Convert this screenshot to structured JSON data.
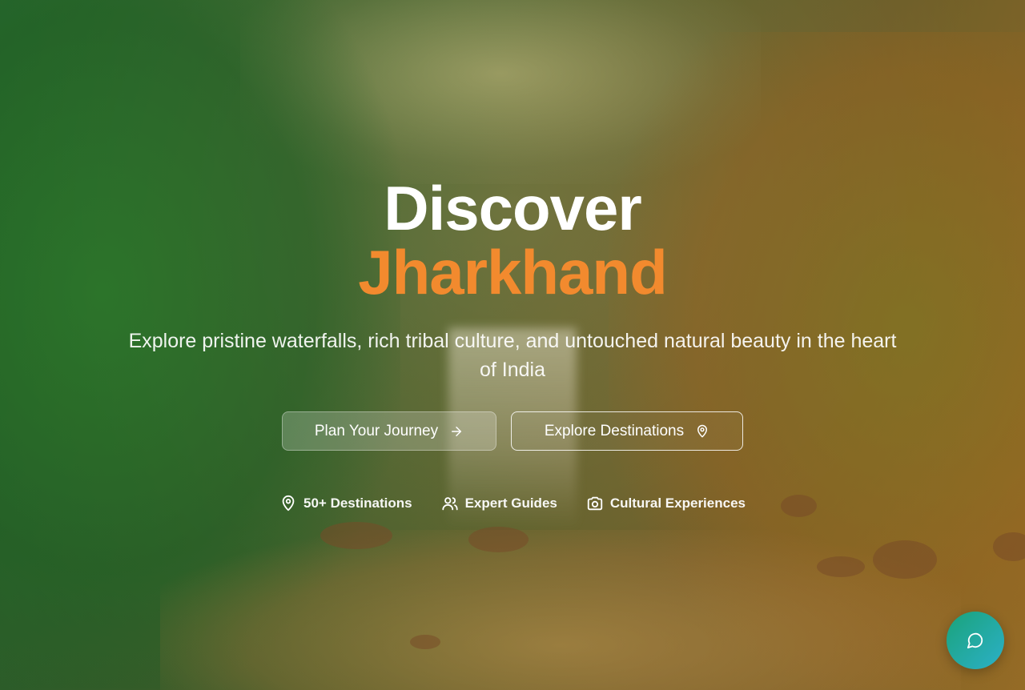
{
  "hero": {
    "title_line1": "Discover",
    "title_line2": "Jharkhand",
    "subtitle": "Explore pristine waterfalls, rich tribal culture, and untouched natural beauty in the heart of India",
    "accent_color": "#f28a2e"
  },
  "buttons": {
    "plan": {
      "label": "Plan Your Journey",
      "icon": "arrow-right-icon"
    },
    "explore": {
      "label": "Explore Destinations",
      "icon": "map-pin-icon"
    }
  },
  "features": [
    {
      "label": "50+ Destinations",
      "icon": "map-pin-icon"
    },
    {
      "label": "Expert Guides",
      "icon": "users-icon"
    },
    {
      "label": "Cultural Experiences",
      "icon": "camera-icon"
    }
  ],
  "chat": {
    "icon": "chat-bubble-icon",
    "colors": [
      "#1aa37a",
      "#2cb0c8"
    ]
  }
}
